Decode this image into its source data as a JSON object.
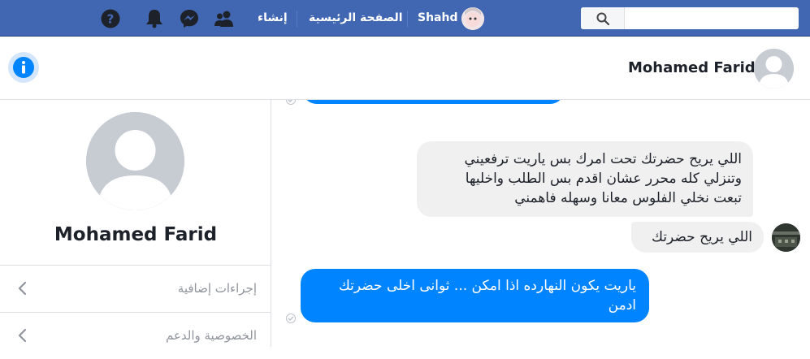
{
  "topbar": {
    "user_name": "Shahd",
    "home_label": "الصفحة الرئيسية",
    "create_label": "إنشاء",
    "search_placeholder": ""
  },
  "conversation": {
    "contact_name": "Mohamed Farid"
  },
  "left_panel": {
    "profile_name": "Mohamed Farid",
    "rows": [
      {
        "label": "إجراءات إضافية"
      },
      {
        "label": "الخصوصية والدعم"
      }
    ]
  },
  "messages": [
    {
      "direction": "incoming",
      "lines": [
        "اللي يريح حضرتك تحت امرك بس ياريت ترفعيني",
        "وتنزلي كله محرر عشان اقدم بس الطلب واخليها",
        "تبعت نخلي الفلوس معانا وسهله فاهمني"
      ]
    },
    {
      "direction": "incoming",
      "lines": [
        "اللي يريح حضرتك"
      ]
    },
    {
      "direction": "outgoing",
      "lines": [
        "ياريت يكون النهارده اذا امكن ... ثوانى اخلى حضرتك",
        "ادمن"
      ]
    }
  ],
  "colors": {
    "brand": "#4267b2",
    "outgoing_bubble": "#0084ff",
    "incoming_bubble": "#f1f0f0"
  }
}
